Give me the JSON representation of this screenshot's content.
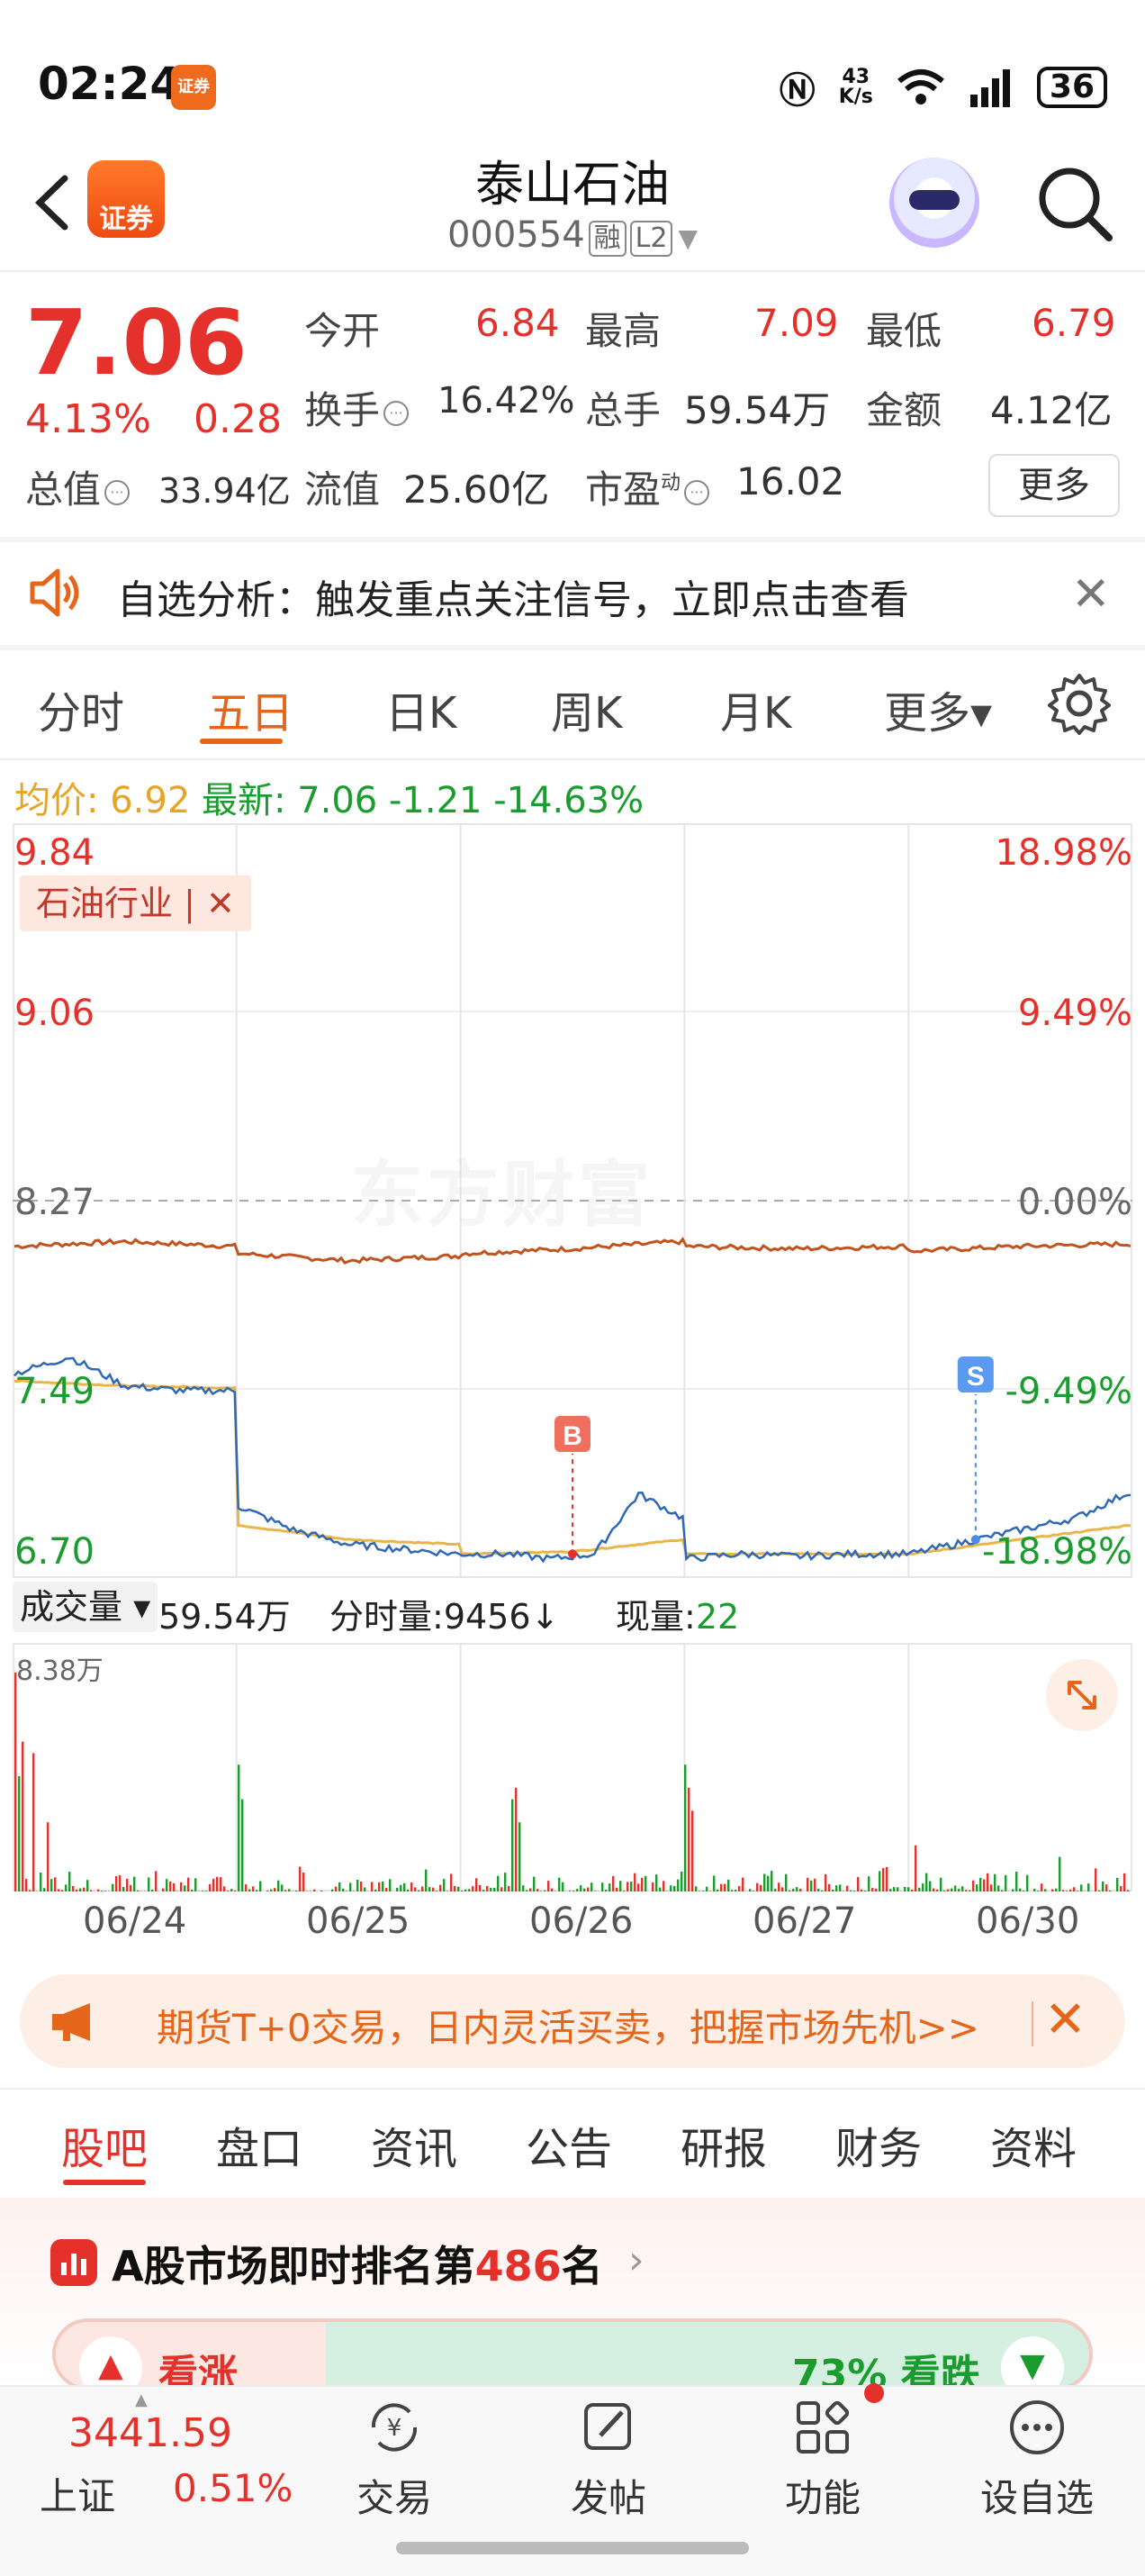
{
  "status_bar": {
    "time": "02:24",
    "app_icon": "证券",
    "speed_value": "43",
    "speed_unit": "K/s",
    "battery": "36"
  },
  "header": {
    "title": "泰山石油",
    "code": "000554",
    "tag1": "融",
    "tag2": "L2",
    "logo_text": "证券"
  },
  "quote": {
    "price": "7.06",
    "change_pct": "4.13%",
    "change_abs": "0.28",
    "open_label": "今开",
    "open": "6.84",
    "high_label": "最高",
    "high": "7.09",
    "low_label": "最低",
    "low": "6.79",
    "turnover_label": "换手",
    "turnover": "16.42%",
    "volume_label": "总手",
    "volume": "59.54万",
    "amount_label": "金额",
    "amount": "4.12亿",
    "mktcap_label": "总值",
    "mktcap": "33.94亿",
    "float_label": "流值",
    "float_cap": "25.60亿",
    "pe_label": "市盈",
    "pe_sup": "动",
    "pe": "16.02",
    "more": "更多"
  },
  "alert": {
    "text": "自选分析：触发重点关注信号，立即点击查看"
  },
  "chart_tabs": [
    "分时",
    "五日",
    "日K",
    "周K",
    "月K",
    "更多▾"
  ],
  "avg_line": {
    "avg_label": "均价:",
    "avg": "6.92",
    "latest_label": "最新:",
    "latest": "7.06",
    "chg": "-1.21",
    "chg_pct": "-14.63%"
  },
  "chart_data": {
    "type": "line",
    "x": [
      "06/24",
      "06/25",
      "06/26",
      "06/27",
      "06/30"
    ],
    "y_left_ticks": [
      "9.84",
      "9.06",
      "8.27",
      "7.49",
      "6.70"
    ],
    "y_right_ticks": [
      "18.98%",
      "9.49%",
      "0.00%",
      "-9.49%",
      "-18.98%"
    ],
    "ylim": [
      6.7,
      9.84
    ],
    "industry_tag": "石油行业 | ✕",
    "watermark": "东方财富",
    "marker_buy": "B",
    "marker_sell": "S",
    "volume_max": "8.38万",
    "colors": {
      "price": "#2f68b5",
      "avg": "#e8b54a",
      "industry": "#c1531f",
      "up": "#e5312b",
      "down": "#1a9c2e"
    }
  },
  "volume_bar": {
    "dropdown": "成交量 ▾",
    "total": "59.54万",
    "fenshi_label": "分时量:",
    "fenshi": "9456↓",
    "now_label": "现量:",
    "now": "22"
  },
  "futures": {
    "text": "期货T+0交易，日内灵活买卖，把握市场先机>>"
  },
  "content_tabs": [
    "股吧",
    "盘口",
    "资讯",
    "公告",
    "研报",
    "财务",
    "资料"
  ],
  "rank": {
    "prefix": "A股市场即时排名第",
    "num": "486",
    "suffix": "名"
  },
  "sentiment": {
    "up": "看涨",
    "down": "73% 看跌"
  },
  "bottom_nav": {
    "index_value": "3441.59",
    "index_name": "上证",
    "index_pct": "0.51%",
    "items": [
      "交易",
      "发帖",
      "功能",
      "设自选"
    ]
  }
}
